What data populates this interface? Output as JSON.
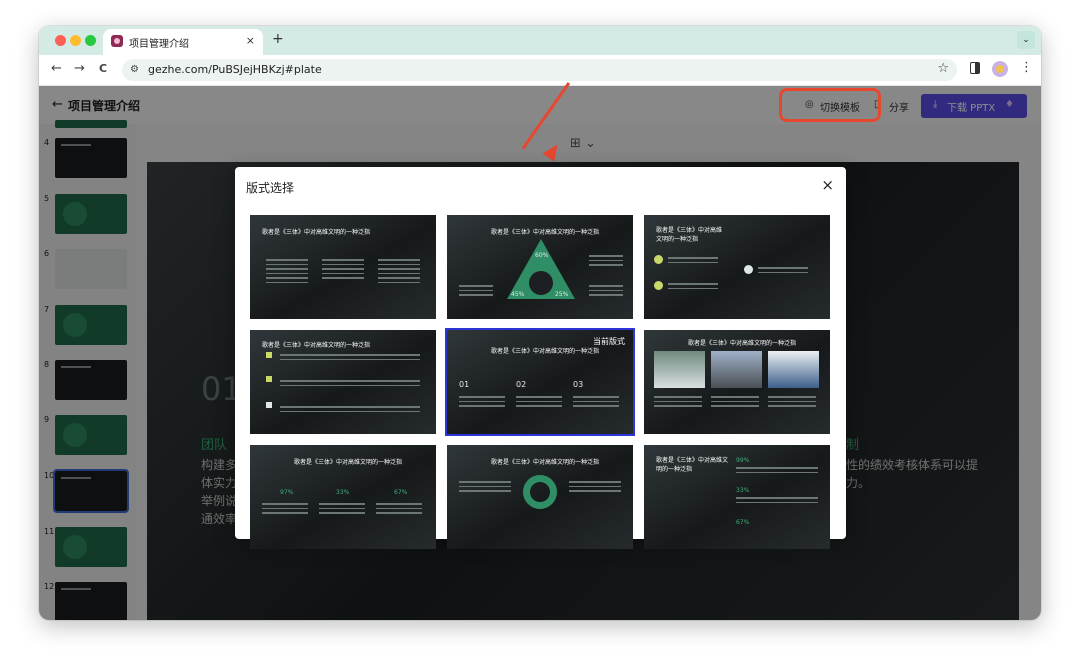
{
  "browser": {
    "tab_title": "项目管理介绍",
    "tab_close": "×",
    "new_tab": "+",
    "tab_dropdown": "⌄",
    "url": "gezhe.com/PuBSJejHBKzj#plate",
    "nav_back": "←",
    "nav_forward": "→",
    "nav_reload": "C",
    "star": "☆",
    "site_info": "⚙",
    "menu": "⋮"
  },
  "app": {
    "back": "←",
    "title": "项目管理介绍",
    "switch_template": "切换模板",
    "share": "分享",
    "download": "下载 PPTX",
    "layout_switch_icon": "⊞ ⌄"
  },
  "sidebar": {
    "slides": [
      {
        "num": "4"
      },
      {
        "num": "5"
      },
      {
        "num": "6"
      },
      {
        "num": "7"
      },
      {
        "num": "8"
      },
      {
        "num": "9"
      },
      {
        "num": "10"
      },
      {
        "num": "11"
      },
      {
        "num": "12"
      }
    ]
  },
  "canvas": {
    "big_num": "01",
    "green_heading": "团队",
    "text_left_1": "构建多",
    "text_left_2": "体实力",
    "text_left_3": "举例说",
    "text_left_4": "通效率。",
    "green_heading_right": "制",
    "text_right_1": "性的绩效考核体系可以提",
    "text_right_2": "力。"
  },
  "modal": {
    "title": "版式选择",
    "close": "×",
    "current_label": "当前版式",
    "card_title": "歌者是《三体》中对高维文明的一种泛指",
    "card_title_a": "歌者是《三体》中对高维",
    "card_title_b": "文明的一种泛指",
    "card_title_c": "歌者是《三体》中对高维文",
    "card_title_d": "明的一种泛指",
    "pct_97": "97%",
    "pct_33": "33%",
    "pct_67": "67%",
    "pct_99": "99%",
    "pct_45": "45%",
    "pct_25": "25%",
    "pct_60": "60%",
    "step_01": "01",
    "step_02": "02",
    "step_03": "03"
  }
}
